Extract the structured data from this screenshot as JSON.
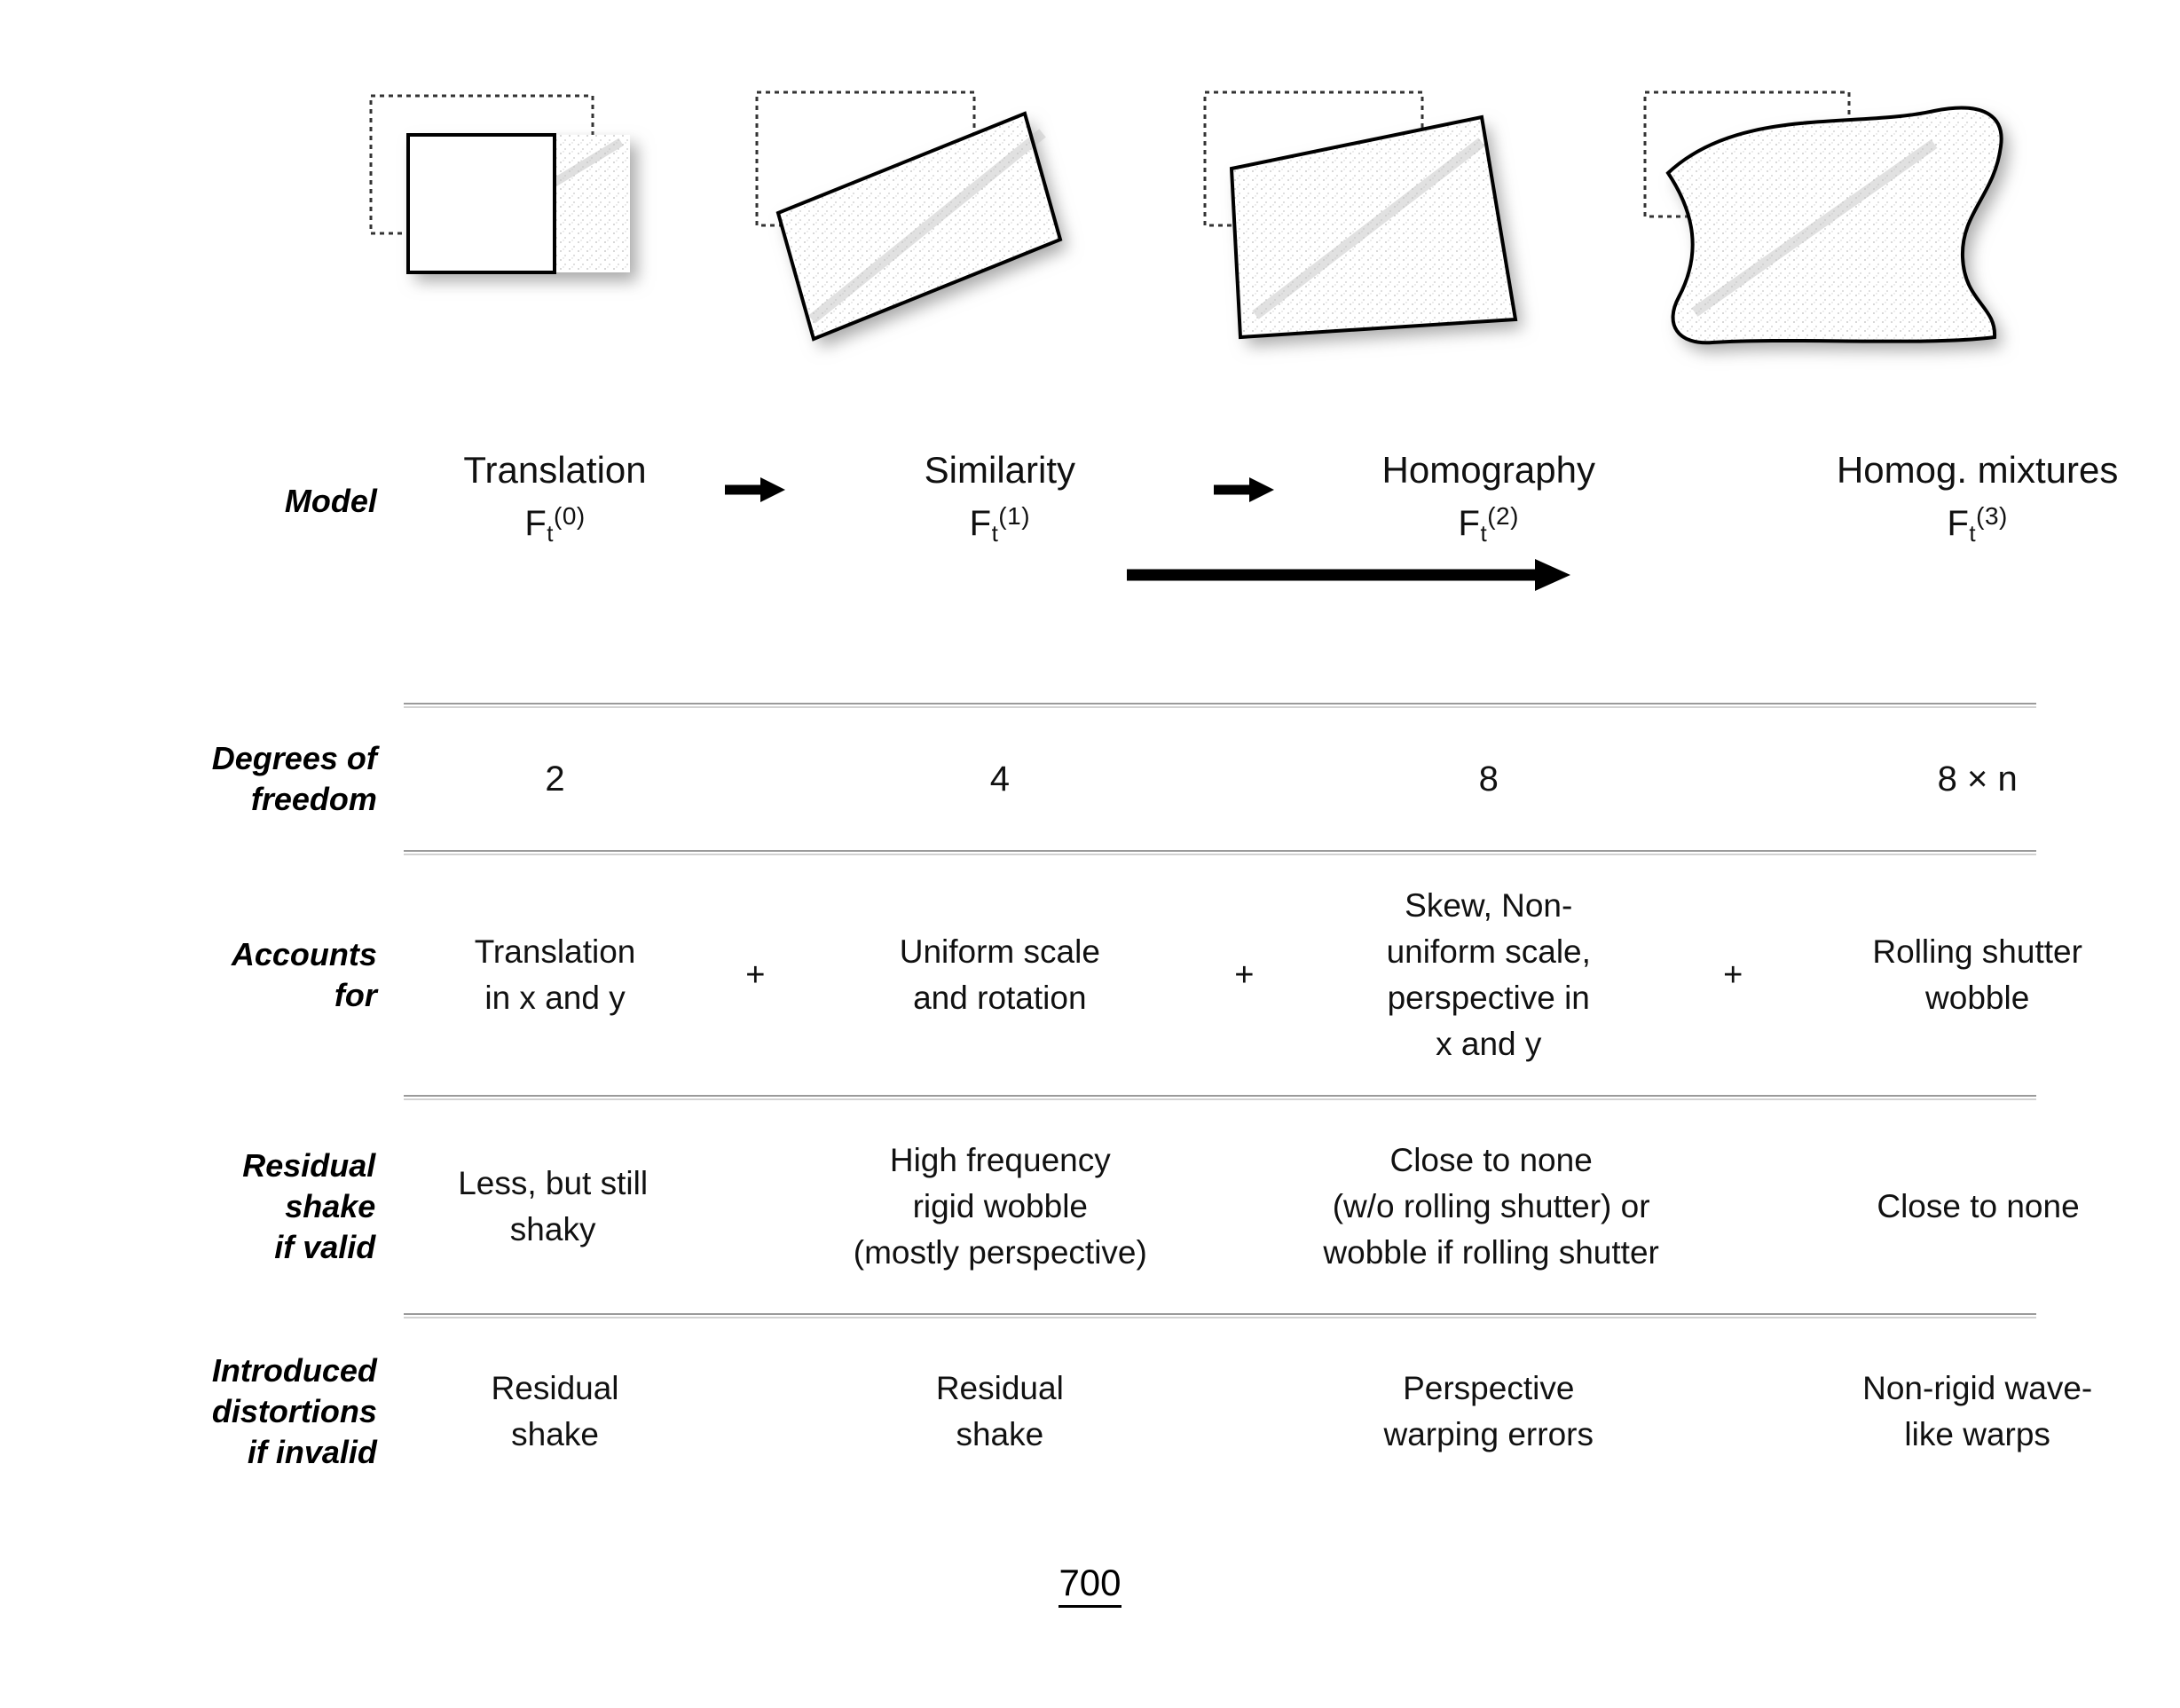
{
  "figure_number": "700",
  "columns": [
    {
      "model_name": "Translation",
      "model_symbol_base": "F",
      "model_symbol_sub": "t",
      "model_symbol_sup": "(0)",
      "dof": "2",
      "accounts_for": "Translation\nin x and y",
      "residual_shake": "Less, but still\nshaky",
      "introduced_distortions": "Residual\nshake",
      "icon": "translated-rectangle-figure"
    },
    {
      "model_name": "Similarity",
      "model_symbol_base": "F",
      "model_symbol_sub": "t",
      "model_symbol_sup": "(1)",
      "dof": "4",
      "accounts_for": "Uniform scale\nand rotation",
      "residual_shake": "High frequency\nrigid wobble\n(mostly perspective)",
      "introduced_distortions": "Residual\nshake",
      "icon": "rotated-scaled-rectangle-figure"
    },
    {
      "model_name": "Homography",
      "model_symbol_base": "F",
      "model_symbol_sub": "t",
      "model_symbol_sup": "(2)",
      "dof": "8",
      "accounts_for": "Skew, Non-\nuniform scale,\nperspective in\nx and y",
      "residual_shake": "Close to none\n(w/o rolling shutter) or\nwobble if rolling shutter",
      "introduced_distortions": "Perspective\nwarping errors",
      "icon": "perspective-quad-figure"
    },
    {
      "model_name": "Homog. mixtures",
      "model_symbol_base": "F",
      "model_symbol_sub": "t",
      "model_symbol_sup": "(3)",
      "dof": "8 × n",
      "accounts_for": "Rolling shutter\nwobble",
      "residual_shake": "Close to none",
      "introduced_distortions": "Non-rigid wave-\nlike warps",
      "icon": "wavy-warped-quad-figure"
    }
  ],
  "row_labels": {
    "model": "Model",
    "dof": "Degrees of\nfreedom",
    "accounts_for": "Accounts\nfor",
    "residual_shake": "Residual\nshake\nif valid",
    "introduced_distortions": "Introduced\ndistortions\nif invalid"
  },
  "separators": {
    "plus": "+",
    "arrow": "→"
  }
}
